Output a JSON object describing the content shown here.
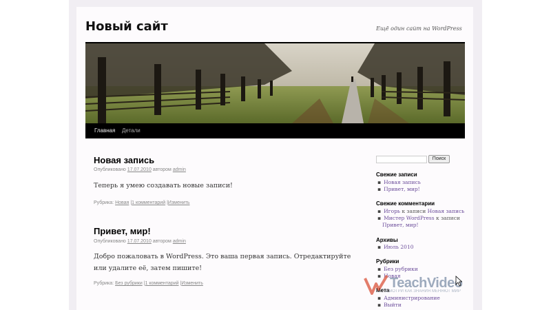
{
  "site": {
    "title": "Новый сайт",
    "description": "Ещё один сайт на WordPress"
  },
  "nav": {
    "items": [
      {
        "label": "Главная"
      },
      {
        "label": "Детали"
      }
    ]
  },
  "posts": [
    {
      "title": "Новая запись",
      "meta_prefix": "Опубликовано",
      "date": "17.07.2010",
      "meta_by": "автором",
      "author": "admin",
      "body": "Теперь я умею создавать новые записи!",
      "util_prefix": "Рубрика:",
      "category": "Новая",
      "sep": "|",
      "comments": "1 комментарий",
      "edit": "Изменить"
    },
    {
      "title": "Привет, мир!",
      "meta_prefix": "Опубликовано",
      "date": "17.07.2010",
      "meta_by": "автором",
      "author": "admin",
      "body": "Добро пожаловать в WordPress. Это ваша первая запись. Отредактируйте или удалите её, затем пишите!",
      "util_prefix": "Рубрика:",
      "category": "Без рубрики",
      "sep": "|",
      "comments": "1 комментарий",
      "edit": "Изменить"
    }
  ],
  "sidebar": {
    "search_button": "Поиск",
    "search_value": "",
    "recent_posts": {
      "title": "Свежие записи",
      "items": [
        "Новая запись",
        "Привет, мир!"
      ]
    },
    "recent_comments": {
      "title": "Свежие комментарии",
      "items": [
        {
          "author": "Игорь",
          "text": "к записи",
          "post": "Новая запись"
        },
        {
          "author": "Мистер WordPress",
          "text": "к записи",
          "post": "Привет, мир!"
        }
      ]
    },
    "archives": {
      "title": "Архивы",
      "items": [
        "Июль 2010"
      ]
    },
    "categories": {
      "title": "Рубрики",
      "items": [
        "Без рубрики",
        "Новая"
      ]
    },
    "meta": {
      "title": "Мета",
      "items": [
        "Администрирование",
        "Выйти"
      ]
    }
  },
  "watermark": {
    "brand": "TeachVideo",
    "tagline": "СМОТРИ КАК ЗНАНИЯ МЕНЯЮТ МИР"
  },
  "colors": {
    "link": "#6b4c9a",
    "nav_bg": "#000000",
    "page_bg": "#f1eef3"
  }
}
